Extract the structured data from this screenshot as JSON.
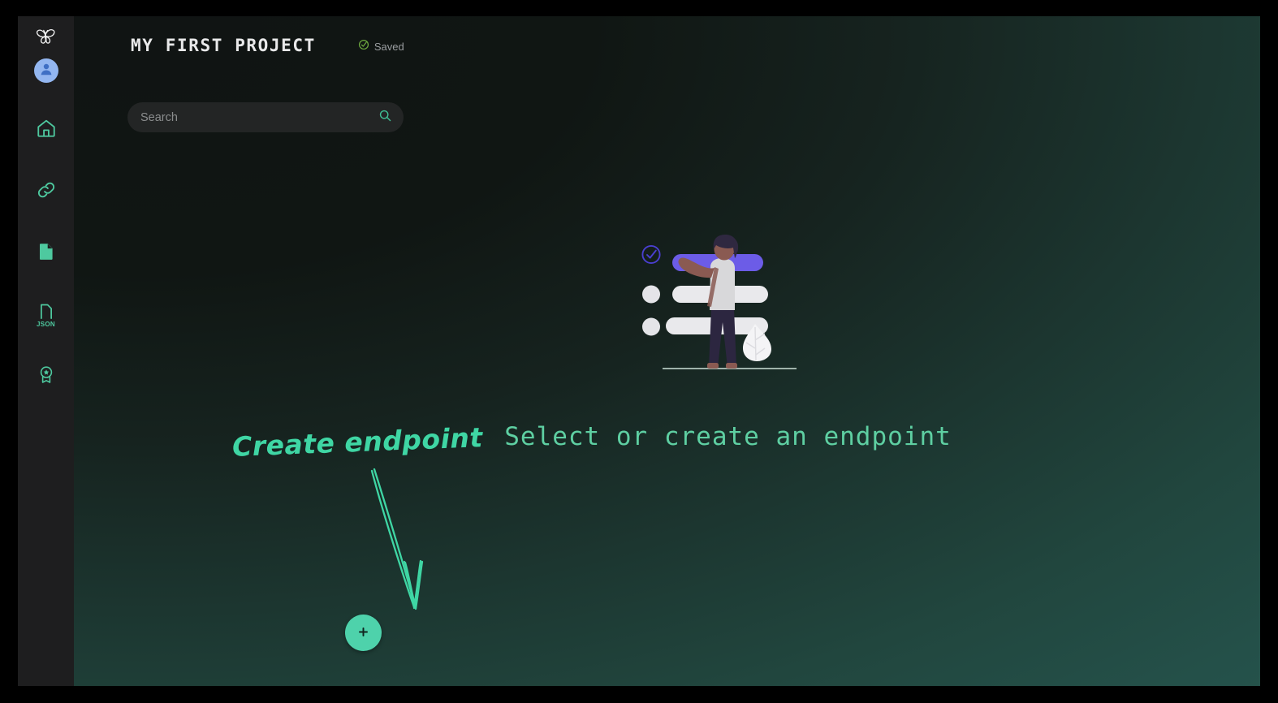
{
  "window": {
    "background_color": "#000000"
  },
  "sidebar": {
    "logo": {
      "icon": "butterfly-logo-icon",
      "color": "#ffffff"
    },
    "avatar": {
      "icon": "user-avatar-icon",
      "background": "#93b6f0",
      "glyph_color": "#3f6fc4"
    },
    "items": [
      {
        "icon": "home-icon",
        "label": "Home",
        "color": "#4ec99f"
      },
      {
        "icon": "link-icon",
        "label": "Links",
        "color": "#4ec99f"
      },
      {
        "icon": "document-icon",
        "label": "Documents",
        "color": "#4ec99f"
      },
      {
        "icon": "json-file-icon",
        "label": "JSON",
        "color": "#4ec99f"
      },
      {
        "icon": "award-badge-icon",
        "label": "Badge",
        "color": "#4ec99f"
      }
    ]
  },
  "header": {
    "title": "MY FIRST PROJECT",
    "saved_label": "Saved",
    "saved_icon": "check-circle-icon",
    "saved_icon_color": "#6ea83f"
  },
  "search": {
    "placeholder": "Search",
    "value": "",
    "icon": "search-icon",
    "icon_color": "#3fbf94"
  },
  "main": {
    "empty_state_title": "Select or create an endpoint",
    "empty_state_title_color": "#5ecfa2",
    "illustration": "person-with-checklist-illustration"
  },
  "annotation": {
    "text": "Create endpoint",
    "color": "#3fd6a4",
    "arrow": "hand-drawn-down-arrow"
  },
  "fab": {
    "icon": "plus-icon",
    "label": "+",
    "background": "#4ed2ab",
    "glyph_color": "#10251f"
  },
  "colors": {
    "accent_green": "#4ed2ab",
    "sidebar_bg": "#1e1e1f",
    "main_bg_start": "#101413",
    "main_bg_end": "#26544c",
    "illustration_blue": "#6c5ce7"
  }
}
